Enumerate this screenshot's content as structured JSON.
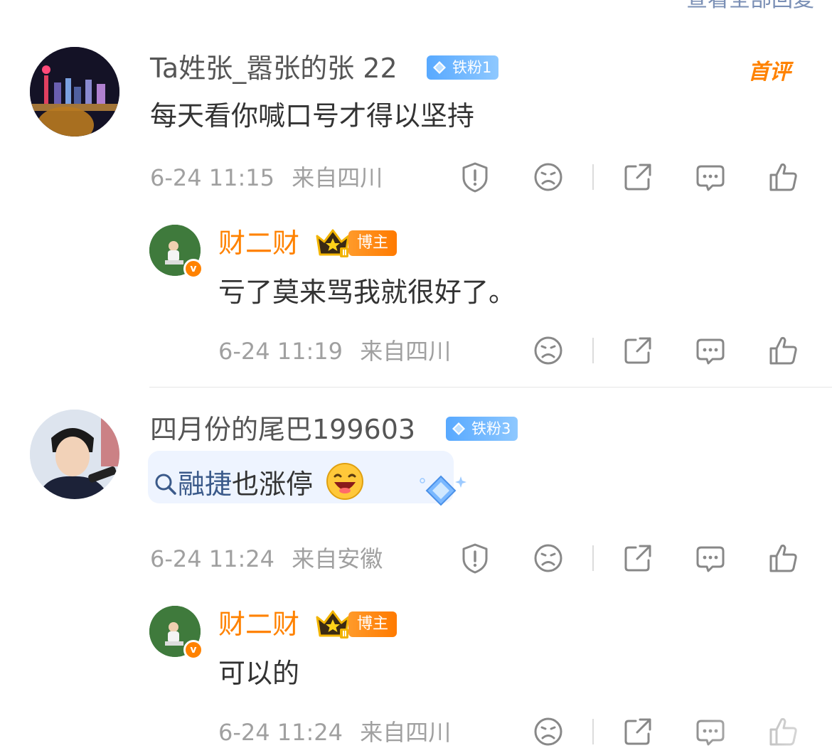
{
  "top_partial_text": "查看全部回复",
  "comments": [
    {
      "username": "Ta姓张_嚣张的张 22",
      "fan_badge": "铁粉1",
      "first_tag": "首评",
      "text": "每天看你喊口号才得以坚持",
      "time": "6-24 11:15",
      "location": "来自四川",
      "reply": {
        "username": "财二财",
        "host_badge": "博主",
        "text": "亏了莫来骂我就很好了。",
        "time": "6-24 11:19",
        "location": "来自四川"
      }
    },
    {
      "username": "四月份的尾巴199603",
      "fan_badge": "铁粉3",
      "topic": "融捷",
      "text_after_topic": "也涨停",
      "time": "6-24 11:24",
      "location": "来自安徽",
      "reply": {
        "username": "财二财",
        "host_badge": "博主",
        "text": "可以的",
        "time": "6-24 11:24",
        "location": "来自四川"
      }
    }
  ],
  "icons": [
    "report-icon",
    "dislike-icon",
    "share-icon",
    "comment-icon",
    "like-icon"
  ],
  "colors": {
    "accent": "#ff8200",
    "fan_badge": "#58a9ff",
    "meta": "#a0a0a0",
    "icon": "#888888"
  }
}
